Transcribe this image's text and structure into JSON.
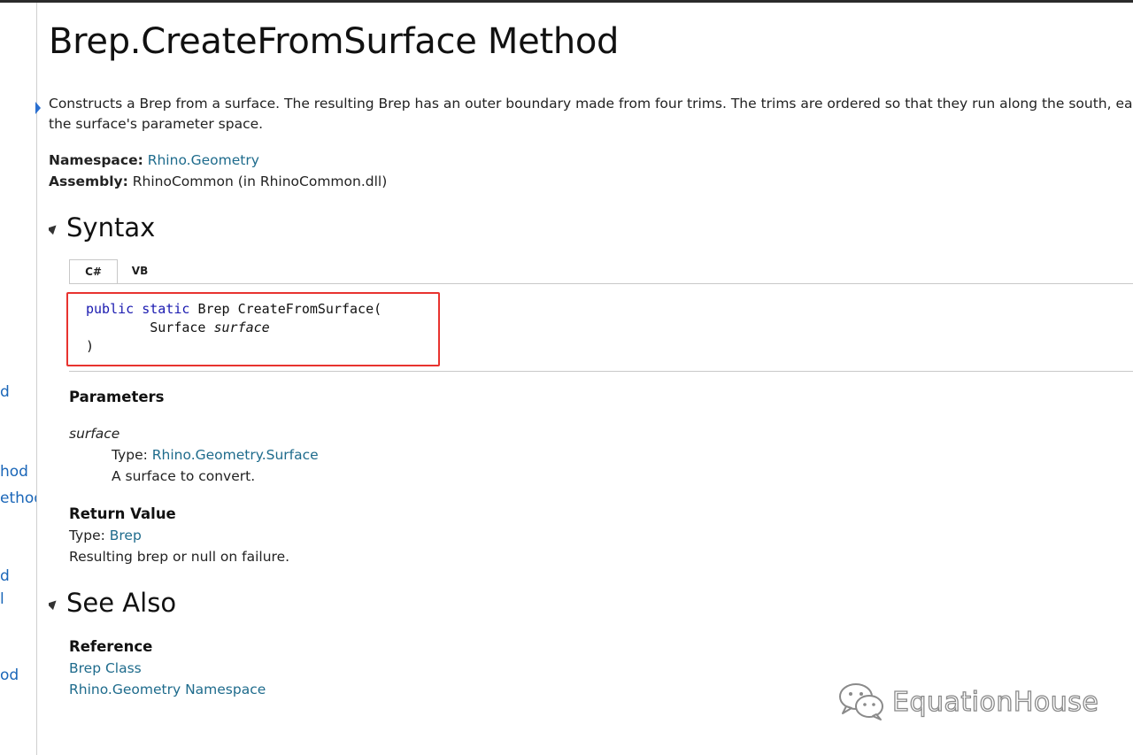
{
  "sidebar": {
    "fragments": [
      "d",
      "hod",
      "ethod",
      "d",
      "l",
      "od"
    ]
  },
  "page": {
    "title": "Brep.CreateFromSurface Method",
    "summary_line1": "Constructs a Brep from a surface. The resulting Brep has an outer boundary made from four trims. The trims are ordered so that they run along the south, ea",
    "summary_line2": "the surface's parameter space.",
    "namespace_label": "Namespace:",
    "namespace_value": "Rhino.Geometry",
    "assembly_label": "Assembly:",
    "assembly_value": "RhinoCommon (in RhinoCommon.dll)"
  },
  "syntax": {
    "heading": "Syntax",
    "tabs": [
      {
        "label": "C#",
        "active": true
      },
      {
        "label": "VB",
        "active": false
      }
    ],
    "code": {
      "kw_public": "public",
      "kw_static": "static",
      "signature": "Brep CreateFromSurface(",
      "param_type": "Surface",
      "param_name": "surface",
      "close": ")"
    }
  },
  "parameters": {
    "heading": "Parameters",
    "name": "surface",
    "type_label": "Type:",
    "type_value": "Rhino.Geometry.Surface",
    "description": "A surface to convert."
  },
  "return_value": {
    "heading": "Return Value",
    "type_label": "Type:",
    "type_value": "Brep",
    "description": "Resulting brep or null on failure."
  },
  "see_also": {
    "heading": "See Also",
    "reference_heading": "Reference",
    "links": [
      "Brep Class",
      "Rhino.Geometry Namespace"
    ]
  },
  "watermark": {
    "text": "EquationHouse",
    "icon": "wechat-icon"
  },
  "colors": {
    "link": "#1e6b8c",
    "keyword": "#1a1ab0",
    "highlight_border": "#e8332f"
  }
}
